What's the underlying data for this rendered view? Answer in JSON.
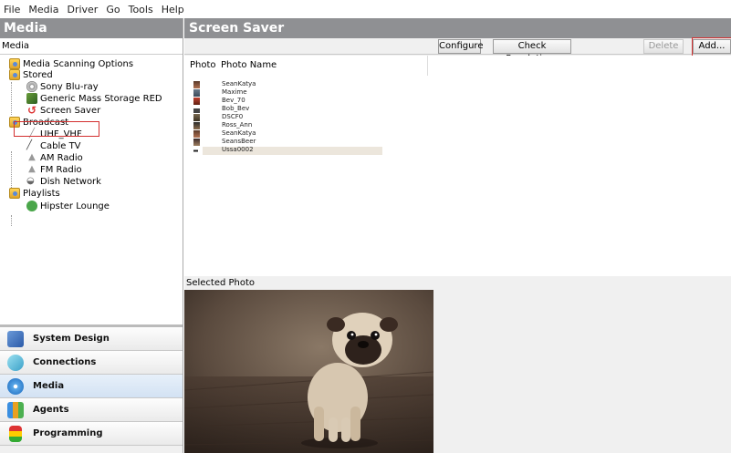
{
  "menu": [
    "File",
    "Media",
    "Driver",
    "Go",
    "Tools",
    "Help"
  ],
  "left": {
    "title": "Media",
    "subheader": "Media",
    "tree": [
      {
        "label": "Media Scanning Options",
        "icon": "folder-icon"
      },
      {
        "label": "Stored",
        "icon": "folder-icon"
      },
      {
        "label": "Sony Blu-ray",
        "icon": "disc-icon"
      },
      {
        "label": "Generic Mass Storage RED",
        "icon": "usb-storage-icon"
      },
      {
        "label": "Screen Saver",
        "icon": "screen-saver-icon"
      },
      {
        "label": "Broadcast",
        "icon": "folder-icon"
      },
      {
        "label": "UHF_VHF",
        "icon": "antenna-icon"
      },
      {
        "label": "Cable TV",
        "icon": "cable-icon"
      },
      {
        "label": "AM Radio",
        "icon": "antenna-icon"
      },
      {
        "label": "FM Radio",
        "icon": "antenna-icon"
      },
      {
        "label": "Dish Network",
        "icon": "dish-icon"
      },
      {
        "label": "Playlists",
        "icon": "folder-icon"
      },
      {
        "label": "Hipster Lounge",
        "icon": "playlist-icon"
      }
    ],
    "splitter_dots": "..........",
    "nav": [
      {
        "label": "System Design",
        "icon": "system-design-icon"
      },
      {
        "label": "Connections",
        "icon": "connections-icon"
      },
      {
        "label": "Media",
        "icon": "media-icon"
      },
      {
        "label": "Agents",
        "icon": "agents-icon"
      },
      {
        "label": "Programming",
        "icon": "programming-icon"
      }
    ]
  },
  "right": {
    "title": "Screen Saver",
    "toolbar": {
      "configure": "Configure",
      "check_resolutions": "Check Resolutions",
      "delete": "Delete",
      "add": "Add..."
    },
    "columns": {
      "photo": "Photo",
      "photo_name": "Photo Name"
    },
    "photos": [
      "SeanKatya",
      "Maxime",
      "Bev_70",
      "Bob_Bev",
      "DSCF0",
      "Ross_Ann",
      "SeanKatya",
      "SeansBeer",
      "Ussa0002"
    ],
    "selected_photo_label": "Selected Photo"
  },
  "colors": {
    "header_bg": "#8f9093",
    "highlight_red": "#d32f2f",
    "selected_row": "#ece6dc"
  }
}
